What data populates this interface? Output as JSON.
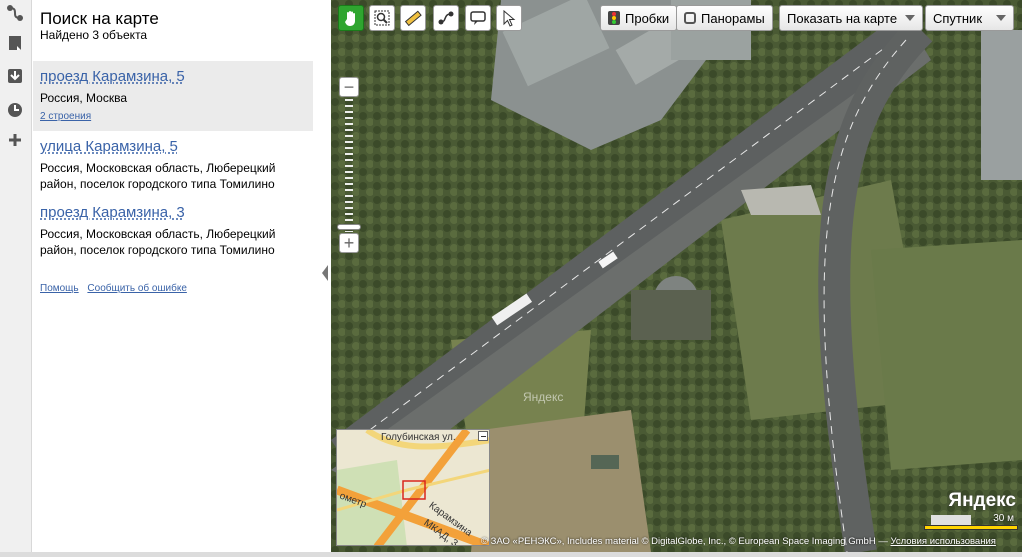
{
  "panel": {
    "title": "Поиск на карте",
    "found": "Найдено 3 объекта",
    "results": [
      {
        "title": "проезд Карамзина, 5",
        "address": "Россия, Москва",
        "extra": "2 строения",
        "selected": true
      },
      {
        "title": "улица Карамзина, 5",
        "address": "Россия, Московская область, Люберецкий район, поселок городского типа Томилино"
      },
      {
        "title": "проезд Карамзина, 3",
        "address": "Россия, Московская область, Люберецкий район, поселок городского типа Томилино"
      }
    ],
    "links": {
      "help": "Помощь",
      "report": "Сообщить об ошибке"
    }
  },
  "rail": {
    "icons": [
      "route-icon",
      "bookmark-icon",
      "download-icon",
      "history-icon",
      "add-icon"
    ]
  },
  "toolbar": {
    "traffic": "Пробки",
    "panoramas": "Панорамы",
    "show_on_map": "Показать на карте",
    "map_type": "Спутник"
  },
  "map": {
    "watermark": "Яндекс",
    "brand": "Яндекс",
    "scale": "30 м",
    "copyright": "© ЗАО «РЕНЭКС», Includes material © DigitalGlobe, Inc., © European Space Imaging GmbH —",
    "terms": "Условия использования",
    "minimap": {
      "street1": "Голубинская ул.",
      "street2": "Карамзина",
      "street3": "МКАД, 3",
      "street4": "ометр"
    }
  },
  "colors": {
    "accent": "#2fa52f",
    "link": "#3a63a8",
    "scale_bar": "#ffd400"
  }
}
